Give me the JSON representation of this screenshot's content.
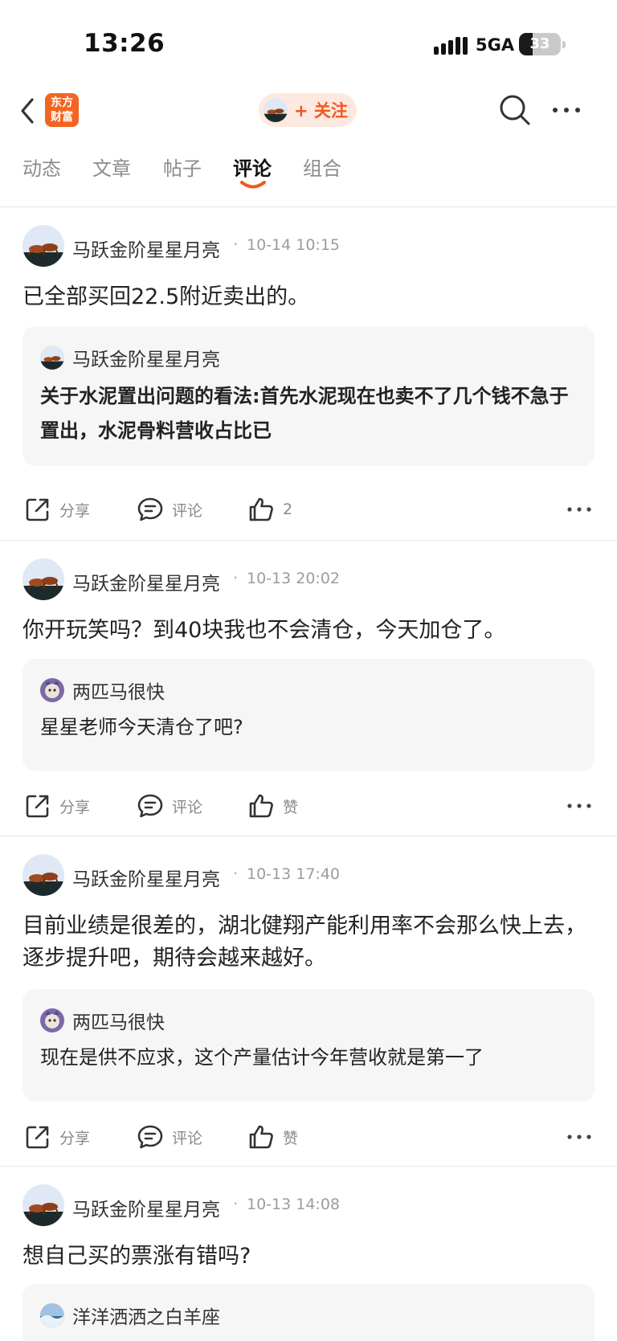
{
  "status_bar": {
    "time": "13:26",
    "network": "5GA",
    "battery": "33",
    "battery_level": 0.33
  },
  "nav": {
    "logo_line1": "东方",
    "logo_line2": "财富",
    "follow_label": "+ 关注",
    "icons": [
      "chevron-left-icon",
      "search-icon",
      "more-horizontal-icon"
    ]
  },
  "tabs": [
    {
      "label": "动态",
      "active": false
    },
    {
      "label": "文章",
      "active": false
    },
    {
      "label": "帖子",
      "active": false
    },
    {
      "label": "评论",
      "active": true
    },
    {
      "label": "组合",
      "active": false
    }
  ],
  "colors": {
    "accent": "#f2581f",
    "logo_bg": "#f26522",
    "pill_bg": "#fde9df",
    "quote_bg": "#f6f6f7"
  },
  "posts": [
    {
      "author": "马跃金阶星星月亮",
      "time": "10-14 10:15",
      "content": "已全部买回22.5附近卖出的。",
      "quote": {
        "author": "马跃金阶星星月亮",
        "text": "关于水泥置出问题的看法:首先水泥现在也卖不了几个钱不急于置出，水泥骨料营收占比已"
      },
      "actions": {
        "share": "分享",
        "comment": "评论",
        "like": "2"
      }
    },
    {
      "author": "马跃金阶星星月亮",
      "time": "10-13 20:02",
      "content": "你开玩笑吗？到40块我也不会清仓，今天加仓了。",
      "quote": {
        "author": "两匹马很快",
        "text": "星星老师今天清仓了吧?"
      },
      "actions": {
        "share": "分享",
        "comment": "评论",
        "like": "赞"
      }
    },
    {
      "author": "马跃金阶星星月亮",
      "time": "10-13 17:40",
      "content": "目前业绩是很差的，湖北健翔产能利用率不会那么快上去，逐步提升吧，期待会越来越好。",
      "quote": {
        "author": "两匹马很快",
        "text": "现在是供不应求，这个产量估计今年营收就是第一了"
      },
      "actions": {
        "share": "分享",
        "comment": "评论",
        "like": "赞"
      }
    },
    {
      "author": "马跃金阶星星月亮",
      "time": "10-13 14:08",
      "content": "想自己买的票涨有错吗?",
      "quote": {
        "author": "洋洋洒洒之白羊座"
      }
    }
  ]
}
